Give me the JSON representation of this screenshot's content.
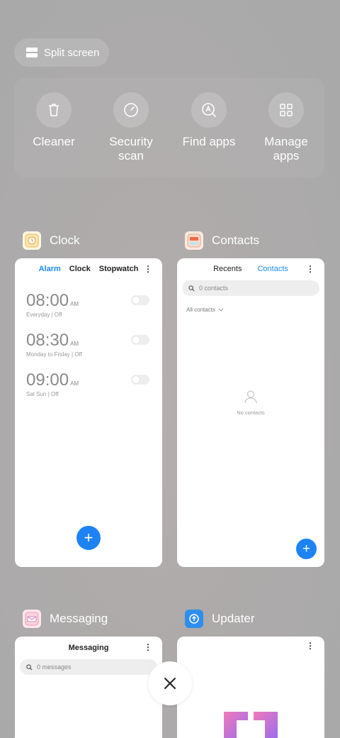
{
  "split_screen": {
    "label": "Split screen",
    "icon": "split-screen-icon"
  },
  "tools": [
    {
      "label": "Cleaner",
      "icon": "trash-icon"
    },
    {
      "label": "Security scan",
      "icon": "security-scan-icon"
    },
    {
      "label": "Find apps",
      "icon": "find-apps-icon"
    },
    {
      "label": "Manage apps",
      "icon": "manage-apps-icon"
    }
  ],
  "apps": {
    "clock": {
      "name": "Clock",
      "tabs": [
        "Alarm",
        "Clock",
        "Stopwatch"
      ],
      "active_tab": "Alarm",
      "menu": "⋮",
      "alarms": [
        {
          "time": "08:00",
          "ampm": "AM",
          "desc": "Everyday | Off",
          "enabled": false
        },
        {
          "time": "08:30",
          "ampm": "AM",
          "desc": "Monday to Friday | Off",
          "enabled": false
        },
        {
          "time": "09:00",
          "ampm": "AM",
          "desc": "Sat Sun | Off",
          "enabled": false
        }
      ],
      "fab": "+"
    },
    "contacts": {
      "name": "Contacts",
      "tabs": [
        "Recents",
        "Contacts"
      ],
      "active_tab": "Contacts",
      "menu": "⋮",
      "search_placeholder": "0 contacts",
      "filter": "All contacts",
      "empty_text": "No contacts",
      "fab": "+"
    },
    "messaging": {
      "name": "Messaging",
      "title": "Messaging",
      "menu": "⋮",
      "search_placeholder": "0 messages"
    },
    "updater": {
      "name": "Updater",
      "menu": "⋮"
    }
  },
  "close_button": {
    "label": "×"
  },
  "colors": {
    "accent": "#1d83f5",
    "tab_active": "#1a8cff"
  }
}
